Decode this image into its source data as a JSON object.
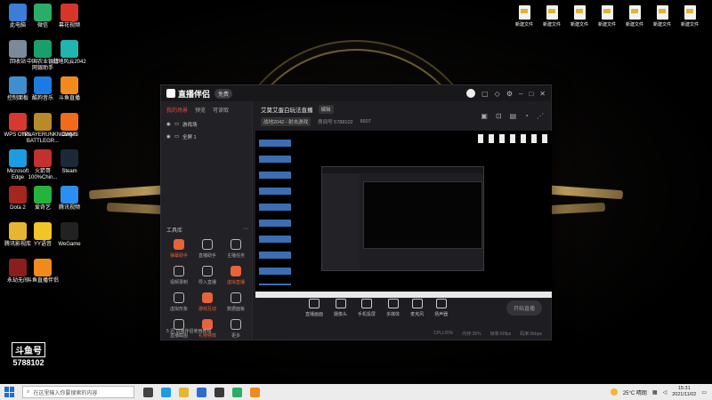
{
  "desktop": {
    "left_icons": [
      {
        "label": "此电脑",
        "icon": "computer-icon",
        "color": "#3b7dd8"
      },
      {
        "label": "微信",
        "icon": "wechat-icon",
        "color": "#2aae67"
      },
      {
        "label": "幕花视频",
        "icon": "video-app-icon",
        "color": "#d8352a"
      },
      {
        "label": "回收站",
        "icon": "recycle-bin-icon",
        "color": "#7a8a99"
      },
      {
        "label": "中国农业银行网银助手",
        "icon": "bank-icon",
        "color": "#1a9e6c"
      },
      {
        "label": "战地风云2042",
        "icon": "battlefield-icon",
        "color": "#22b5b0"
      },
      {
        "label": "控制面板",
        "icon": "control-panel-icon",
        "color": "#3e8ed0"
      },
      {
        "label": "酷狗音乐",
        "icon": "kugou-icon",
        "color": "#1d7ae0"
      },
      {
        "label": "斗鱼直播",
        "icon": "douyu-icon",
        "color": "#f08a1c"
      },
      {
        "label": "WPS Office",
        "icon": "wps-icon",
        "color": "#d63a2f"
      },
      {
        "label": "PLAYERUNKNOWN'S BATTLEGR...",
        "icon": "pubg-icon",
        "color": "#b98a2a"
      },
      {
        "label": "Origin",
        "icon": "origin-icon",
        "color": "#f06c1c"
      },
      {
        "label": "Microsoft Edge",
        "icon": "edge-icon",
        "color": "#1b9de2"
      },
      {
        "label": "火箭哥 100%Chin...",
        "icon": "rocket-icon",
        "color": "#c23030"
      },
      {
        "label": "Steam",
        "icon": "steam-icon",
        "color": "#1b2838"
      },
      {
        "label": "Dota 2",
        "icon": "dota-icon",
        "color": "#a3261f"
      },
      {
        "label": "爱奇艺",
        "icon": "iqiyi-icon",
        "color": "#24b33d"
      },
      {
        "label": "腾讯视频",
        "icon": "tencent-video-icon",
        "color": "#2a8ff0"
      },
      {
        "label": "腾讯影视库",
        "icon": "folder-icon",
        "color": "#e8b533"
      },
      {
        "label": "YY语音",
        "icon": "yy-icon",
        "color": "#f4c326"
      },
      {
        "label": "WeGame",
        "icon": "wegame-icon",
        "color": "#222"
      },
      {
        "label": "永劫无间",
        "icon": "naraka-icon",
        "color": "#8a1d1d"
      },
      {
        "label": "斗鱼直播伴侣",
        "icon": "douyu-companion-icon",
        "color": "#f08a1c"
      }
    ],
    "right_icons": [
      {
        "label": "新建文件"
      },
      {
        "label": "新建文件"
      },
      {
        "label": "新建文件"
      },
      {
        "label": "新建文件"
      },
      {
        "label": "新建文件"
      },
      {
        "label": "新建文件"
      },
      {
        "label": "新建文件"
      }
    ],
    "watermark_label": "斗鱼号",
    "watermark_number": "5788102"
  },
  "app": {
    "name": "直播伴侣",
    "version_pill": "免费",
    "left_tabs": [
      "我的场景",
      "预览",
      "可读取"
    ],
    "scenes": [
      {
        "name": "游戏场"
      },
      {
        "name": "全屏 1"
      }
    ],
    "tools_title": "工具库",
    "tools": [
      {
        "label": "弹幕助手",
        "hot": true
      },
      {
        "label": "直播助手",
        "hot": false
      },
      {
        "label": "主播任务",
        "hot": false
      },
      {
        "label": "视频录制",
        "hot": false
      },
      {
        "label": "导入直播",
        "hot": false
      },
      {
        "label": "虚拟直播",
        "hot": true
      },
      {
        "label": "虚拟形象",
        "hot": false
      },
      {
        "label": "游戏互动",
        "hot": true
      },
      {
        "label": "数据面板",
        "hot": false
      },
      {
        "label": "直播截图",
        "hot": false
      },
      {
        "label": "礼物特效",
        "hot": true
      },
      {
        "label": "更多",
        "hot": false
      }
    ],
    "left_footer": "5 迅 直播伴侣使用教程",
    "main_title": "艾莫艾蛋白玩法直播",
    "main_title_badge": "编辑",
    "sub_items": [
      "战地2042 - 射击游戏",
      "房间号 5788102",
      "6607"
    ],
    "bottom_buttons": [
      "直播画面",
      "摄像头",
      "手机投屏",
      "多媒体",
      "麦克风",
      "扬声器"
    ],
    "start_label": "开始直播",
    "status": [
      "CPU:20%",
      "内存:35%",
      "帧率:60fps",
      "码率:0kbps"
    ]
  },
  "taskbar": {
    "search_placeholder": "在这里输入你要搜索的内容",
    "weather": "25°C 晴朗",
    "time": "15:31",
    "date": "2021/11/02",
    "apps": [
      {
        "icon": "task-view-icon",
        "color": "#444"
      },
      {
        "icon": "edge-icon",
        "color": "#1b9de2"
      },
      {
        "icon": "file-explorer-icon",
        "color": "#e8b533"
      },
      {
        "icon": "mail-icon",
        "color": "#2a6fd0"
      },
      {
        "icon": "store-icon",
        "color": "#3a3a3a"
      },
      {
        "icon": "wechat-icon",
        "color": "#2aae67"
      },
      {
        "icon": "douyu-icon",
        "color": "#f08a1c"
      }
    ]
  }
}
